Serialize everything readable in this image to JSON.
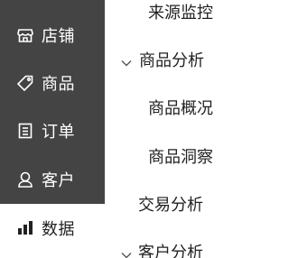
{
  "sidebar": {
    "items": [
      {
        "label": "店铺",
        "icon": "store-icon"
      },
      {
        "label": "商品",
        "icon": "tag-icon"
      },
      {
        "label": "订单",
        "icon": "order-list-icon"
      },
      {
        "label": "客户",
        "icon": "user-icon"
      },
      {
        "label": "数据",
        "icon": "bar-chart-icon",
        "active": true
      }
    ],
    "colors": {
      "background": "#444444",
      "text": "#ffffff",
      "active_text": "#222222"
    }
  },
  "submenu": {
    "items": [
      {
        "label": "来源监控"
      },
      {
        "label": "商品分析",
        "expanded": true,
        "icon": "chevron-down-icon"
      },
      {
        "label": "商品概况"
      },
      {
        "label": "商品洞察"
      },
      {
        "label": "交易分析"
      },
      {
        "label": "客户分析",
        "expanded": true,
        "icon": "chevron-down-icon"
      }
    ]
  }
}
